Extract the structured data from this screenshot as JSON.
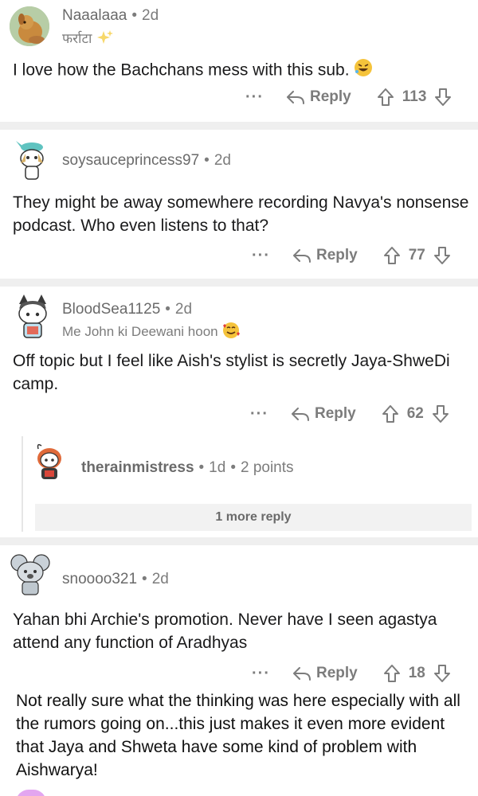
{
  "comments": [
    {
      "username": "Naaalaaa",
      "age": "2d",
      "flair": "फर्राटा",
      "text": "I love how the Bachchans mess with this sub.",
      "reply_label": "Reply",
      "score": "113",
      "more": "···"
    },
    {
      "username": "soysauceprincess97",
      "age": "2d",
      "text": "They might be away somewhere recording Navya's nonsense podcast. Who even listens to that?",
      "reply_label": "Reply",
      "score": "77",
      "more": "···"
    },
    {
      "username": "BloodSea1125",
      "age": "2d",
      "flair": "Me John ki Deewani hoon",
      "text": "Off topic but I feel like Aish's stylist is secretly Jaya-ShweDi camp.",
      "reply_label": "Reply",
      "score": "62",
      "more": "···"
    },
    {
      "username": "therainmistress",
      "age": "1d",
      "points": "2 points"
    },
    {
      "username": "snoooo321",
      "age": "2d",
      "text": "Yahan bhi Archie's promotion. Never have I seen agastya attend any function of Aradhyas",
      "reply_label": "Reply",
      "score": "18",
      "more": "···"
    }
  ],
  "more_reply_label": "1 more reply",
  "caption_text": "Not really sure what the thinking was here especially with all the rumors going on...this just makes it even more evident that Jaya and Shweta have some kind of problem with Aishwarya!",
  "colors": {
    "separator": "#efefef",
    "meta_gray": "#7c7c7c",
    "text": "#1a1a1b"
  }
}
